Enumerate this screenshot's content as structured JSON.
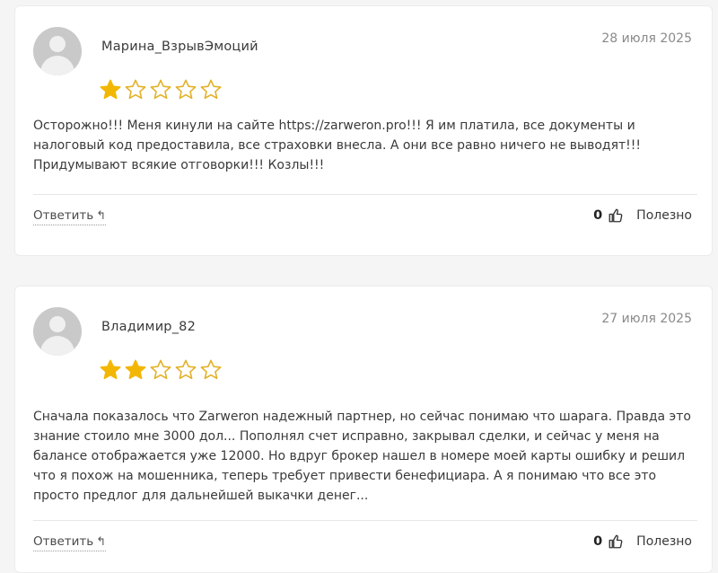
{
  "colors": {
    "star_filled": "#f2b705",
    "star_empty": "#e3b22b"
  },
  "reviews": [
    {
      "author": "Марина_ВзрывЭмоций",
      "date": "28 июля 2025",
      "rating": 1,
      "rating_max": 5,
      "text": "Осторожно!!! Меня кинули на сайте https://zarweron.pro!!! Я им платила, все документы и налоговый код предоставила, все страховки внесла. А они все равно ничего не выводят!!! Придумывают всякие отговорки!!! Козлы!!!",
      "reply_label": "Ответить",
      "likes": "0",
      "useful_label": "Полезно"
    },
    {
      "author": "Владимир_82",
      "date": "27 июля 2025",
      "rating": 2,
      "rating_max": 5,
      "text": "Сначала показалось что Zarweron надежный партнер, но сейчас понимаю что шарага. Правда это знание стоило мне 3000 дол... Пополнял счет исправно, закрывал сделки, и сейчас у меня на балансе отображается уже 12000. Но вдруг брокер нашел в номере моей карты ошибку и решил что я похож на мошенника, теперь требует привести бенефициара. А я понимаю что все это просто предлог для дальнейшей выкачки денег...",
      "reply_label": "Ответить",
      "likes": "0",
      "useful_label": "Полезно"
    }
  ]
}
